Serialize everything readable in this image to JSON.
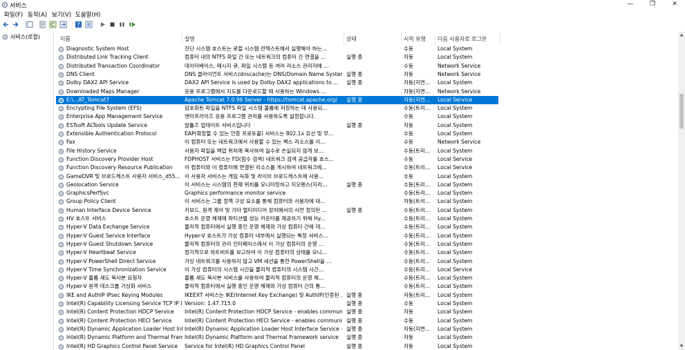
{
  "window": {
    "title": "서비스",
    "minimize": "—",
    "maximize": "❐",
    "close": "✕"
  },
  "menu": [
    "파일(F)",
    "동작(A)",
    "보기(V)",
    "도움말(H)"
  ],
  "nav": {
    "root": "서비스(로컬)"
  },
  "columns": {
    "name": "이름",
    "desc": "설명",
    "status": "상태",
    "start": "시작 유형",
    "logon": "다음 사용자로 로그온"
  },
  "colors": {
    "selection": "#0078d7",
    "gear": "#7a8aa0"
  },
  "rows": [
    {
      "name": "Diagnostic System Host",
      "desc": "진단 시스템 호스트는 로컬 시스템 컨텍스트에서 실행해야 하는...",
      "status": "",
      "start": "수동",
      "logon": "Local System"
    },
    {
      "name": "Distributed Link Tracking Client",
      "desc": "컴퓨터 내의 NTFS 파일 간 또는 네트워크의 컴퓨터 간 연결을 ...",
      "status": "실행 중",
      "start": "자동",
      "logon": "Local System"
    },
    {
      "name": "Distributed Transaction Coordinator",
      "desc": "데이터베이스, 메시지 큐, 파일 시스템 등 여러 리소스 관리자에 ...",
      "status": "",
      "start": "수동",
      "logon": "Network Service"
    },
    {
      "name": "DNS Client",
      "desc": "DNS 클라이언트 서비스(dnscache)는 DNS(Domain Name System...",
      "status": "실행 중",
      "start": "자동",
      "logon": "Network Service"
    },
    {
      "name": "Dolby DAX2 API Service",
      "desc": "DAX2 API Service is used by Dolby DAX2 applications to ...",
      "status": "실행 중",
      "start": "자동(지연...",
      "logon": "Local System"
    },
    {
      "name": "Downloaded Maps Manager",
      "desc": "응용 프로그램에서 지도를 다운로드할 때 사용하는 Windows ...",
      "status": "",
      "start": "자동(지연...",
      "logon": "Network Service"
    },
    {
      "name": "E:\\...AT_Tomcat7",
      "desc": "Apache Tomcat 7.0.96 Server - https://tomcat.apache.org/",
      "status": "실행 중",
      "start": "자동(지연...",
      "logon": "Local Service",
      "selected": true
    },
    {
      "name": "Encrypting File System (EFS)",
      "desc": "암호화된 파일을 NTFS 파일 시스템 볼륨에 저장하는 데 사용되...",
      "status": "",
      "start": "수동(트리...",
      "logon": "Local System"
    },
    {
      "name": "Enterprise App Management Service",
      "desc": "엔터프라이즈 응용 프로그램 관리를 사용하도록 설정합니다.",
      "status": "",
      "start": "수동",
      "logon": "Local System"
    },
    {
      "name": "ESTsoft ALTools Update Service",
      "desc": "알툴즈 업데이트 서비스입니다",
      "status": "실행 중",
      "start": "자동",
      "logon": "Local System"
    },
    {
      "name": "Extensible Authentication Protocol",
      "desc": "EAP(확장할 수 있는 인증 프로토콜) 서비스는 802.1x 유선 및 무...",
      "status": "",
      "start": "수동",
      "logon": "Local System"
    },
    {
      "name": "Fax",
      "desc": "이 컴퓨터 또는 네트워크에서 사용할 수 있는 팩스 리소스를 이...",
      "status": "",
      "start": "수동",
      "logon": "Network Service"
    },
    {
      "name": "File History Service",
      "desc": "사용자 파일을 백업 위치에 복사하여 실수로 손실되지 않게 보...",
      "status": "",
      "start": "수동(트리...",
      "logon": "Local System"
    },
    {
      "name": "Function Discovery Provider Host",
      "desc": "FDPHOST 서비스는 FD(함수 검색) 네트워크 검색 공급자를 호스...",
      "status": "",
      "start": "수동",
      "logon": "Local Service"
    },
    {
      "name": "Function Discovery Resource Publication",
      "desc": "이 컴퓨터와 이 컴퓨터에 연결된 리소스를 게시하여 네트워크에...",
      "status": "",
      "start": "수동(트리...",
      "logon": "Local Service"
    },
    {
      "name": "GameDVR 및 브로드캐스트 사용자 서비스_d55...",
      "desc": "이 사용자 서비스는 게임 녹화 및 라이브 브로드캐스트에 사용...",
      "status": "",
      "start": "수동",
      "logon": "Local System"
    },
    {
      "name": "Geolocation Service",
      "desc": "이 서비스는 시스템의 현재 위치를 모니터링하고 지오펜스(지리...",
      "status": "실행 중",
      "start": "수동(트리...",
      "logon": "Local System"
    },
    {
      "name": "GraphicsPerfSvc",
      "desc": "Graphics performance monitor service",
      "status": "",
      "start": "수동(트리...",
      "logon": "Local System"
    },
    {
      "name": "Group Policy Client",
      "desc": "이 서비스는 그룹 정책 구성 요소를 통해 컴퓨터와 사용자에 대...",
      "status": "",
      "start": "자동(트리...",
      "logon": "Local System"
    },
    {
      "name": "Human Interface Device Service",
      "desc": "키보드, 원격 제어 및 기타 멀티미디어 장치에서의 사전 정의된 ...",
      "status": "실행 중",
      "start": "수동(트리...",
      "logon": "Local System"
    },
    {
      "name": "HV 호스트 서비스",
      "desc": "호스트 운영 체제에 파티션별 성능 카운터를 제공하기 위해 Hy...",
      "status": "",
      "start": "수동(트리...",
      "logon": "Local System"
    },
    {
      "name": "Hyper-V Data Exchange Service",
      "desc": "물리적 컴퓨터에서 실행 중인 운영 체제와 가상 컴퓨터 간에 데...",
      "status": "",
      "start": "수동(트리...",
      "logon": "Local System"
    },
    {
      "name": "Hyper-V Guest Service Interface",
      "desc": "Hyper-V 호스트가 가상 컴퓨터 내부에서 실행되는 특정 서비스...",
      "status": "",
      "start": "수동(트리...",
      "logon": "Local System"
    },
    {
      "name": "Hyper-V Guest Shutdown Service",
      "desc": "물리적 컴퓨터의 관리 인터페이스에서 이 가상 컴퓨터의 운영 ...",
      "status": "",
      "start": "수동(트리...",
      "logon": "Local System"
    },
    {
      "name": "Hyper-V Heartbeat Service",
      "desc": "정기적으로 하트비트를 보고하여 이 가상 컴퓨터의 상태를 모니...",
      "status": "",
      "start": "수동(트리...",
      "logon": "Local System"
    },
    {
      "name": "Hyper-V PowerShell Direct Service",
      "desc": "가상 네트워크를 사용하지 않고 VM 세션을 통한 PowerShell을 ...",
      "status": "",
      "start": "수동(트리...",
      "logon": "Local System"
    },
    {
      "name": "Hyper-V Time Synchronization Service",
      "desc": "이 가상 컴퓨터의 시스템 시간을 물리적 컴퓨터의 시스템 시간...",
      "status": "",
      "start": "수동(트리...",
      "logon": "Local Service"
    },
    {
      "name": "Hyper-V 볼륨 섀도 복사본 요청자",
      "desc": "볼륨 섀도 복사본 서비스를 사용하여 물리적 컴퓨터의 운영 체...",
      "status": "",
      "start": "수동(트리...",
      "logon": "Local System"
    },
    {
      "name": "Hyper-V 원격 데스크톱 가상화 서비스",
      "desc": "물리적 컴퓨터에서 실행 중인 운영 체제와 가상 컴퓨터 간의 통...",
      "status": "",
      "start": "수동(트리...",
      "logon": "Local System"
    },
    {
      "name": "IKE and AuthIP IPsec Keying Modules",
      "desc": "IKEEXT 서비스는 IKE(Internet Key Exchange) 및 AuthIP(인증된 ...",
      "status": "실행 중",
      "start": "자동(트리...",
      "logon": "Local System"
    },
    {
      "name": "Intel(R) Capability Licensing Service TCP IP Inte...",
      "desc": "Version: 1.47.715.0",
      "status": "실행 중",
      "start": "수동",
      "logon": "Local System"
    },
    {
      "name": "Intel(R) Content Protection HDCP Service",
      "desc": "Intel(R) Content Protection HDCP Service - enables communicati...",
      "status": "실행 중",
      "start": "자동",
      "logon": "Local System"
    },
    {
      "name": "Intel(R) Content Protection HECI Service",
      "desc": "Intel(R) Content Protection HECI Service - enables communicatio...",
      "status": "실행 중",
      "start": "수동",
      "logon": "Local System"
    },
    {
      "name": "Intel(R) Dynamic Application Loader Host Interf...",
      "desc": "Intel(R) Dynamic Application Loader Host Interface Service - Allo...",
      "status": "실행 중",
      "start": "자동(지연...",
      "logon": "Local System"
    },
    {
      "name": "Intel(R) Dynamic Platform and Thermal Framew...",
      "desc": "Intel(R) Dynamic Platform and Thermal Framework service",
      "status": "실행 중",
      "start": "자동",
      "logon": "Local System"
    },
    {
      "name": "Intel(R) HD Graphics Control Panel Service",
      "desc": "Service for Intel(R) HD Graphics Control Panel",
      "status": "실행 중",
      "start": "자동",
      "logon": "Local System"
    }
  ]
}
